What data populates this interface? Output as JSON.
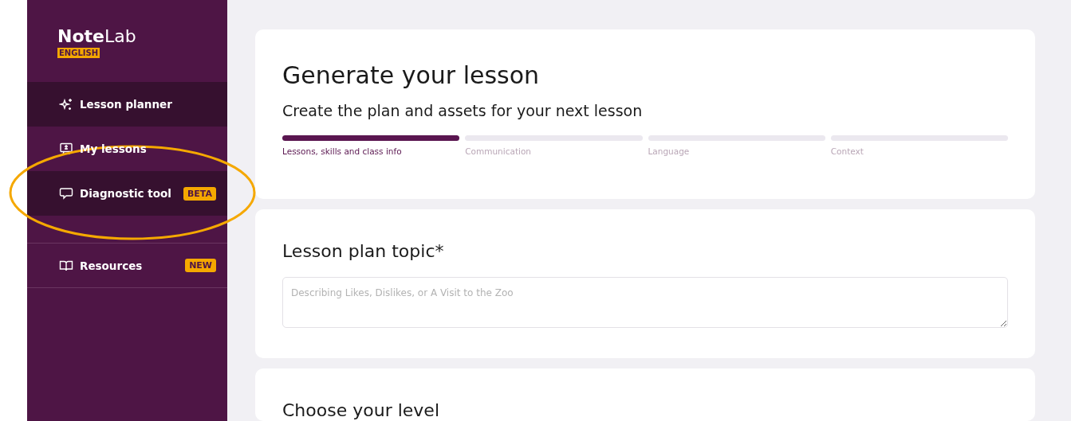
{
  "logo": {
    "name": "**Note**Lab",
    "badge": "ENGLISH"
  },
  "sidebar": {
    "groups": [
      {
        "items": [
          {
            "label": "Lesson planner",
            "selected": true
          },
          {
            "label": "My lessons",
            "selected": false
          },
          {
            "label": "Diagnostic tool",
            "selected": true,
            "badge": "BETA",
            "circled": true
          }
        ]
      },
      {
        "items": [
          {
            "label": "Resources",
            "selected": false,
            "badge": "NEW"
          }
        ]
      }
    ]
  },
  "header": {
    "title": "Generate your lesson",
    "subtitle": "Create the plan and assets for your next lesson",
    "steps": [
      {
        "label": "Lessons, skills and class info",
        "selected": true
      },
      {
        "label": "Communication",
        "selected": false
      },
      {
        "label": "Language",
        "selected": false
      },
      {
        "label": "Context",
        "selected": false
      }
    ]
  },
  "topic": {
    "title": "Lesson plan topic*",
    "placeholder": "Describing Likes, Dislikes, or A Visit to the Zoo"
  },
  "level": {
    "title": "Choose your level"
  }
}
